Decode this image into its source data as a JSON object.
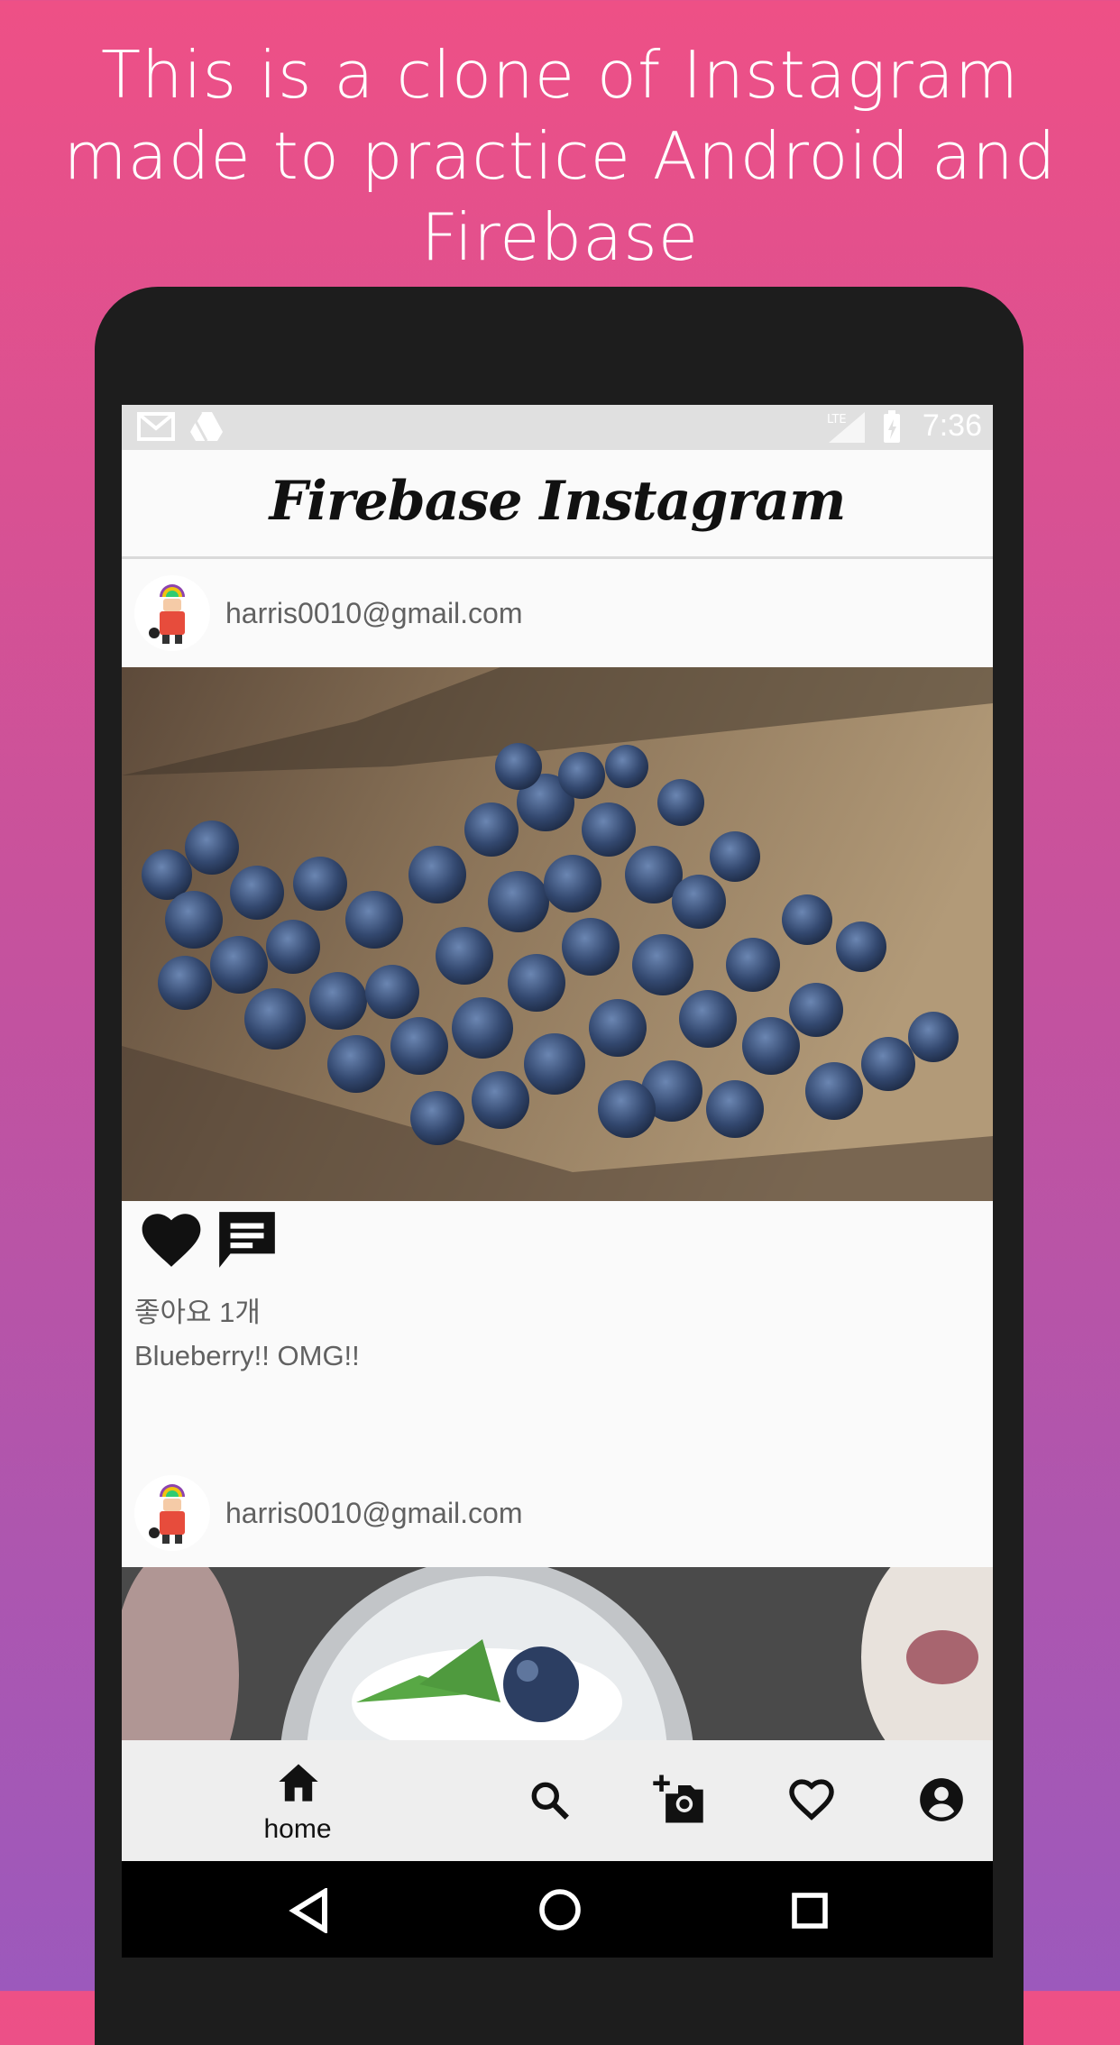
{
  "headline": [
    "This is a clone of Instagram",
    "made to practice Android and",
    "Firebase"
  ],
  "status": {
    "time": "7:36",
    "network": "LTE"
  },
  "app": {
    "title": "Firebase Instagram"
  },
  "posts": [
    {
      "user": "harris0010@gmail.com",
      "likes": "좋아요 1개",
      "caption": "Blueberry!! OMG!!"
    },
    {
      "user": "harris0010@gmail.com"
    }
  ],
  "bottom_nav": {
    "home_label": "home",
    "icons": [
      "home-icon",
      "search-icon",
      "add-photo-icon",
      "favorite-icon",
      "account-icon"
    ]
  },
  "colors": {
    "gradient_top": "#EE5086",
    "gradient_bottom": "#9C59BC",
    "device": "#1d1d1d"
  }
}
